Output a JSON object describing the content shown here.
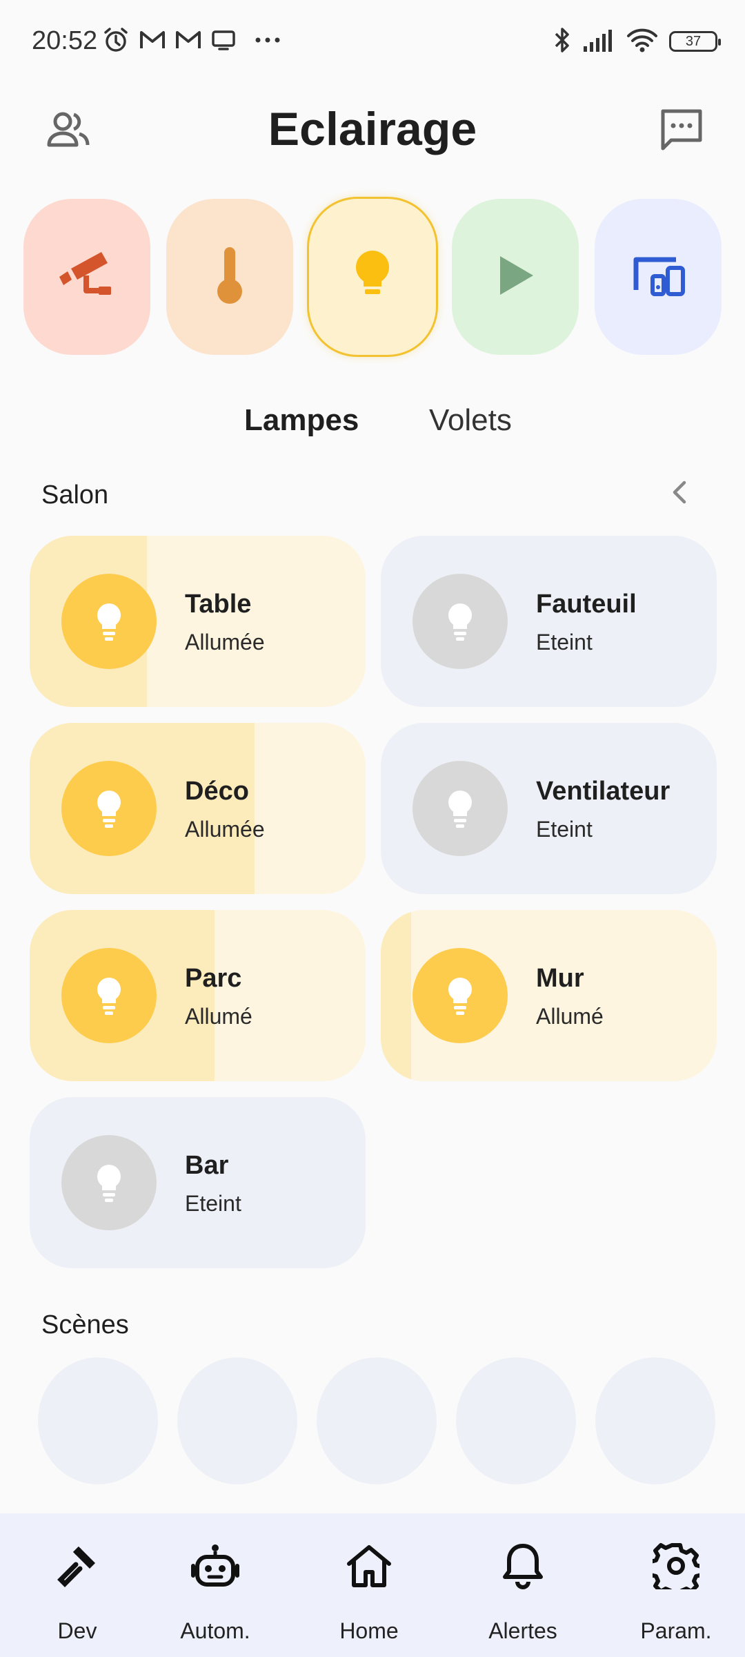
{
  "status_bar": {
    "time": "20:52",
    "battery": "37",
    "left_icons": [
      "alarm-icon",
      "gmail-icon",
      "gmail-icon",
      "cast-icon",
      "more-dots-icon"
    ],
    "right_icons": [
      "bluetooth-icon",
      "signal-icon",
      "wifi-icon",
      "battery-icon"
    ]
  },
  "header": {
    "title": "Eclairage",
    "left_icon": "users-icon",
    "right_icon": "chat-icon"
  },
  "categories": [
    {
      "icon": "security-camera-icon",
      "bg": "#fdd9cf",
      "color": "#d4542c",
      "active": false
    },
    {
      "icon": "thermometer-icon",
      "bg": "#fbe3cc",
      "color": "#e0923a",
      "active": false
    },
    {
      "icon": "bulb-icon",
      "bg": "#fdf1ce",
      "color": "#fbbf12",
      "active": true
    },
    {
      "icon": "play-icon",
      "bg": "#def3dc",
      "color": "#7ba682",
      "active": false
    },
    {
      "icon": "devices-icon",
      "bg": "#e9edfd",
      "color": "#2f5bd3",
      "active": false
    }
  ],
  "tabs": [
    {
      "label": "Lampes",
      "active": true
    },
    {
      "label": "Volets",
      "active": false
    }
  ],
  "room": {
    "name": "Salon",
    "collapse_icon": "chevron-left-icon"
  },
  "lights": [
    {
      "name": "Table",
      "state": "Allumée",
      "on": true,
      "level": 0.35
    },
    {
      "name": "Fauteuil",
      "state": "Eteint",
      "on": false,
      "level": 0
    },
    {
      "name": "Déco",
      "state": "Allumée",
      "on": true,
      "level": 0.67
    },
    {
      "name": "Ventilateur",
      "state": "Eteint",
      "on": false,
      "level": 0
    },
    {
      "name": "Parc",
      "state": "Allumé",
      "on": true,
      "level": 0.55
    },
    {
      "name": "Mur",
      "state": "Allumé",
      "on": true,
      "level": 0.09
    },
    {
      "name": "Bar",
      "state": "Eteint",
      "on": false,
      "level": 0
    }
  ],
  "scenes": {
    "title": "Scènes",
    "count": 5
  },
  "nav": [
    {
      "label": "Dev",
      "icon": "hammer-icon"
    },
    {
      "label": "Autom.",
      "icon": "robot-icon"
    },
    {
      "label": "Home",
      "icon": "home-icon"
    },
    {
      "label": "Alertes",
      "icon": "bell-icon"
    },
    {
      "label": "Param.",
      "icon": "gear-icon"
    }
  ],
  "colors": {
    "tile_on": "#fdf5df",
    "tile_on_fill": "#fcebbb",
    "tile_off": "#edf0f6",
    "bulb_on": "#fdcc4d",
    "bulb_off": "#d9d8d8",
    "nav_bg": "#eef1fb"
  }
}
